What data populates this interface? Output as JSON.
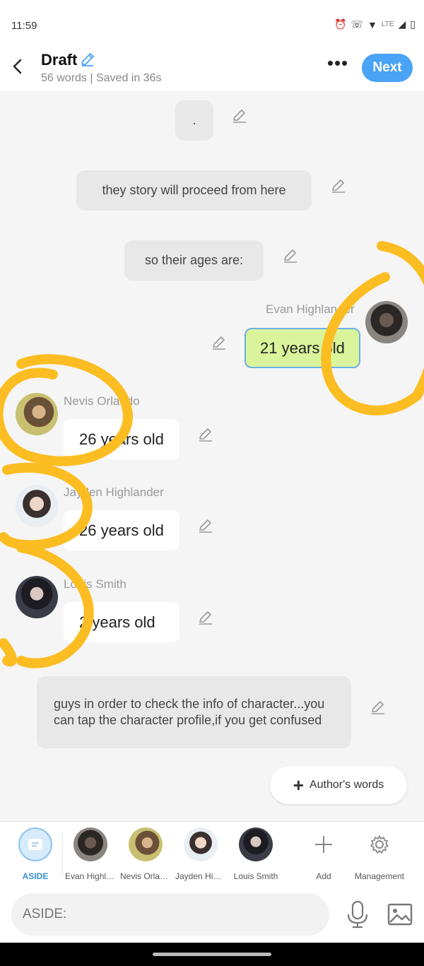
{
  "status": {
    "time": "11:59",
    "network": "LTE"
  },
  "header": {
    "title": "Draft",
    "subtitle": "56 words | Saved in 36s",
    "more_label": "•••",
    "next_label": "Next"
  },
  "messages": {
    "aside_1": ".",
    "aside_2": "they story will proceed from here",
    "aside_3": "so their ages are:",
    "evan": {
      "name": "Evan Highlander",
      "text": "21 years old"
    },
    "nevis": {
      "name": "Nevis Orlando",
      "text": "26 years old"
    },
    "jayden": {
      "name": "Jayden Highlander",
      "text": "26 years old"
    },
    "louis": {
      "name": "Louis Smith",
      "text": "2 years old"
    },
    "aside_4": "guys in order to check the info of character...you can tap the character profile,if you get confused"
  },
  "authors_words_label": "Author's words",
  "char_bar": {
    "aside": "ASIDE",
    "evan": "Evan Highlander",
    "nevis": "Nevis Orlando",
    "jayden": "Jayden Highlander",
    "louis": "Louis Smith",
    "add": "Add",
    "management": "Management"
  },
  "input": {
    "placeholder": "ASIDE:"
  },
  "colors": {
    "accent": "#4aa3f5",
    "highlight_bubble": "#d9f49a",
    "scribble": "#fbbd22"
  }
}
